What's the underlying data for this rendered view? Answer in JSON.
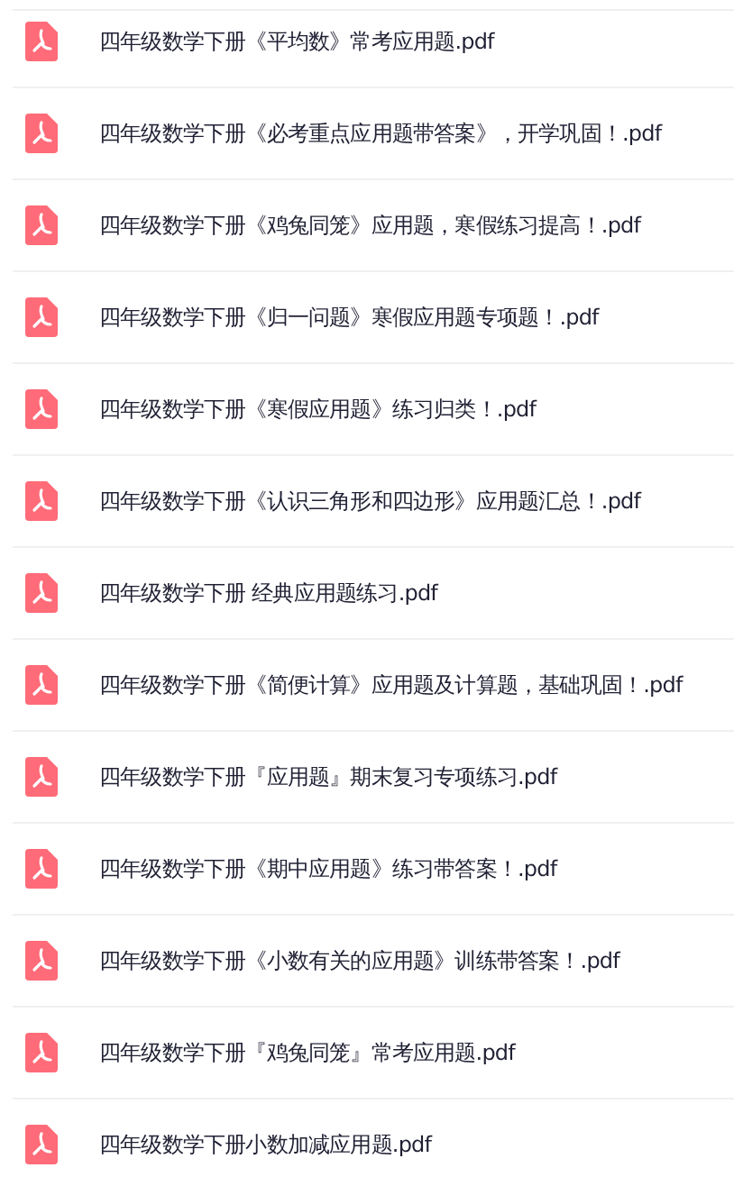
{
  "files": [
    {
      "name": "四年级数学下册《平均数》常考应用题.pdf"
    },
    {
      "name": "四年级数学下册《必考重点应用题带答案》，开学巩固！.pdf"
    },
    {
      "name": "四年级数学下册《鸡兔同笼》应用题，寒假练习提高！.pdf"
    },
    {
      "name": "四年级数学下册《归一问题》寒假应用题专项题！.pdf"
    },
    {
      "name": "四年级数学下册《寒假应用题》练习归类！.pdf"
    },
    {
      "name": "四年级数学下册《认识三角形和四边形》应用题汇总！.pdf"
    },
    {
      "name": "四年级数学下册 经典应用题练习.pdf"
    },
    {
      "name": "四年级数学下册《简便计算》应用题及计算题，基础巩固！.pdf"
    },
    {
      "name": "四年级数学下册『应用题』期末复习专项练习.pdf"
    },
    {
      "name": "四年级数学下册《期中应用题》练习带答案！.pdf"
    },
    {
      "name": "四年级数学下册《小数有关的应用题》训练带答案！.pdf"
    },
    {
      "name": "四年级数学下册『鸡兔同笼』常考应用题.pdf"
    },
    {
      "name": "四年级数学下册小数加减应用题.pdf"
    }
  ]
}
